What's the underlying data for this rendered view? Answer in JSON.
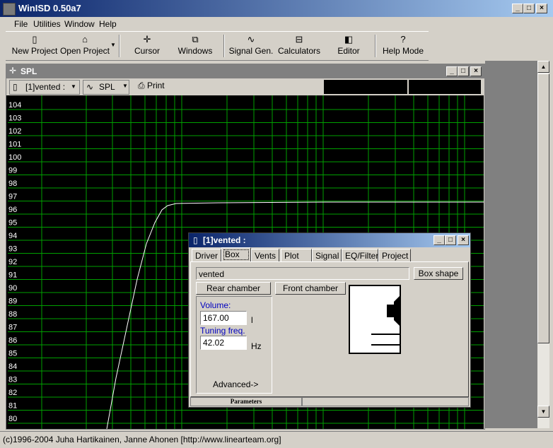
{
  "app": {
    "title": "WinISD 0.50a7"
  },
  "menu": [
    "File",
    "Utilities",
    "Window",
    "Help"
  ],
  "toolbar": {
    "new_project": "New Project",
    "open_project": "Open Project",
    "cursor": "Cursor",
    "windows": "Windows",
    "signal_gen": "Signal Gen.",
    "calculators": "Calculators",
    "editor": "Editor",
    "help_mode": "Help Mode",
    "help_icon": "?"
  },
  "spl_window": {
    "title": "SPL",
    "project_selector": "[1]vented :",
    "graph_selector": "SPL",
    "print_label": "Print"
  },
  "plot": {
    "y_ticks": [
      "104",
      "103",
      "102",
      "101",
      "100",
      "99",
      "98",
      "97",
      "96",
      "95",
      "94",
      "93",
      "92",
      "91",
      "90",
      "89",
      "88",
      "87",
      "86",
      "85",
      "84",
      "83",
      "82",
      "81",
      "80"
    ],
    "y_range": [
      80,
      104
    ],
    "grid": true,
    "grid_color": "#00a000",
    "curve_color": "#ffffff"
  },
  "dialog": {
    "title": "[1]vented :",
    "tabs": [
      "Driver",
      "Box",
      "Vents",
      "Plot",
      "Signal",
      "EQ/Filter",
      "Project"
    ],
    "active_tab": "Box",
    "box_type": "vented",
    "box_shape_button": "Box shape",
    "rear_chamber_button": "Rear chamber",
    "front_chamber_button": "Front chamber",
    "volume_label": "Volume:",
    "volume_value": "167.00",
    "volume_unit": "l",
    "tuning_label": "Tuning freq.",
    "tuning_value": "42.02",
    "tuning_unit": "Hz",
    "advanced_button": "Advanced->",
    "status_tab": "Parameters"
  },
  "status": {
    "text": "(c)1996-2004 Juha Hartikainen, Janne Ahonen [http://www.linearteam.org]"
  }
}
